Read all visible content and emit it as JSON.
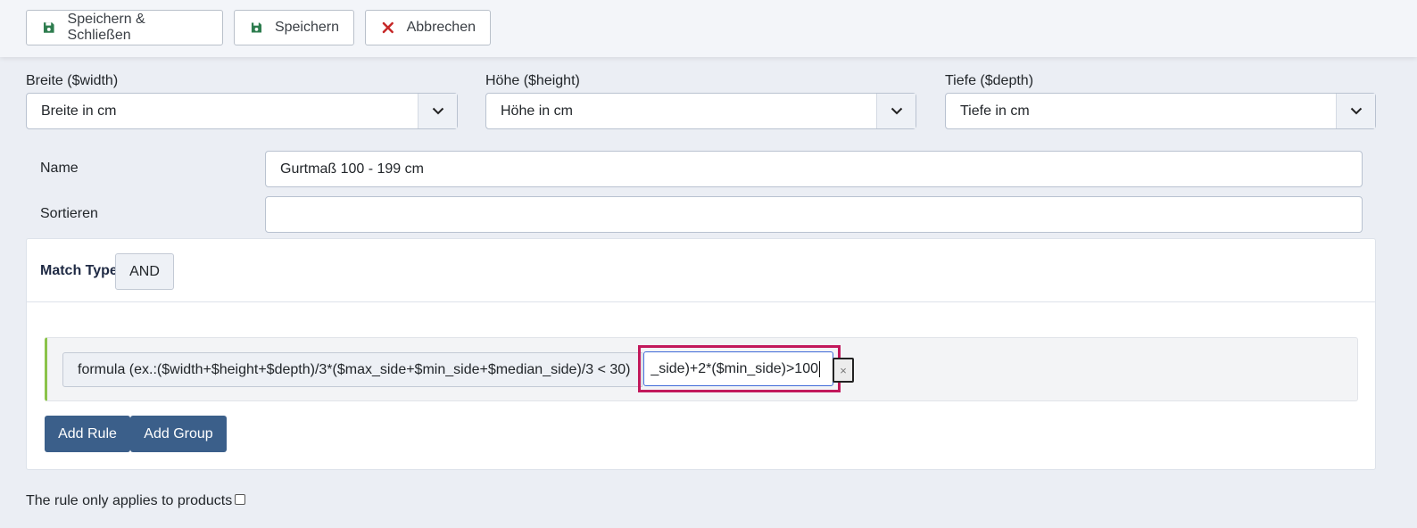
{
  "toolbar": {
    "save_close_label": "Speichern & Schließen",
    "save_label": "Speichern",
    "cancel_label": "Abbrechen"
  },
  "dimensions": {
    "width": {
      "label": "Breite ($width)",
      "value": "Breite in cm"
    },
    "height": {
      "label": "Höhe ($height)",
      "value": "Höhe in cm"
    },
    "depth": {
      "label": "Tiefe ($depth)",
      "value": "Tiefe in cm"
    }
  },
  "form": {
    "name_label": "Name",
    "name_value": "Gurtmaß 100 - 199 cm",
    "sort_label": "Sortieren",
    "sort_value": ""
  },
  "rules": {
    "match_type_label": "Match Type",
    "match_type_value": "AND",
    "rule": {
      "field_label": "formula (ex.:($width+$height+$depth)/3*($max_side+$min_side+$median_side)/3 < 30)",
      "value": "_side)+2*($min_side)>100",
      "remove_symbol": "×"
    },
    "add_rule_label": "Add Rule",
    "add_group_label": "Add Group"
  },
  "footer": {
    "products_only_label": "The rule only applies to products"
  },
  "colors": {
    "save_icon": "#2e7d4f",
    "cancel_icon": "#c62828",
    "primary_button": "#3b5f8a",
    "highlight_border": "#c2185b",
    "rule_accent": "#8bc34a"
  }
}
